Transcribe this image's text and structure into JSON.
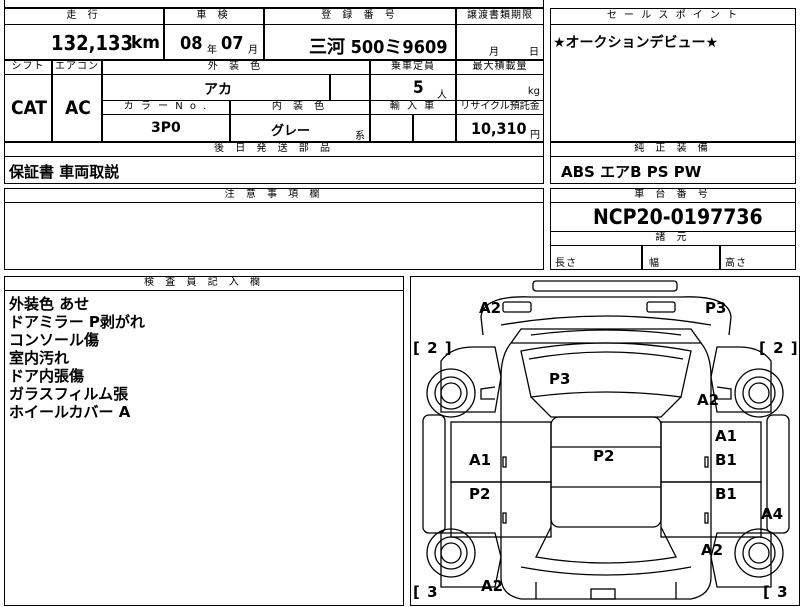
{
  "header": {
    "mileage_label": "走 行",
    "inspection_label": "車 検",
    "registration_label": "登 録 番 号",
    "transfer_label": "譲渡書類期限",
    "sales_point_label": "セ ー ル ス ポ イ ン ト",
    "mileage_value": "132,133",
    "mileage_unit": "km",
    "inspection_year": "08",
    "inspection_year_unit": "年",
    "inspection_month": "07",
    "inspection_month_unit": "月",
    "registration_value": "三河 500ミ9609",
    "transfer_month_unit": "月",
    "transfer_day_unit": "日",
    "sales_point_text": "★オークションデビュー★"
  },
  "specs": {
    "shift_label": "シフト",
    "aircon_label": "エアコン",
    "exterior_color_label": "外 装 色",
    "capacity_label": "乗車定員",
    "max_load_label": "最大積載量",
    "shift_value": "CAT",
    "aircon_value": "AC",
    "exterior_color_value": "アカ",
    "capacity_value": "5",
    "capacity_unit": "人",
    "max_load_unit": "kg",
    "color_no_label": "カ ラ ー N o .",
    "interior_color_label": "内 装 色",
    "import_label": "輸 入 車",
    "recycle_label": "リサイクル預託金",
    "color_no_value": "3P0",
    "interior_color_value": "グレー",
    "interior_color_suffix": "系",
    "recycle_value": "10,310",
    "recycle_unit": "円"
  },
  "parts": {
    "later_parts_label": "後 日 発 送 部 品",
    "later_parts_value": "保証書 車両取説",
    "genuine_equipment_label": "純 正 装 備",
    "genuine_equipment_value": "ABS エアB PS PW"
  },
  "notes": {
    "caution_label": "注 意 事 項 欄",
    "chassis_label": "車 台 番 号",
    "chassis_value": "NCP20-0197736",
    "dimensions_label": "諸 元",
    "length_label": "長さ",
    "width_label": "幅",
    "height_label": "高さ"
  },
  "inspector": {
    "label": "検 査 員 記 入 欄",
    "lines": [
      "外装色 あせ",
      "ドアミラー P剥がれ",
      "コンソール傷",
      "室内汚れ",
      "ドア内張傷",
      "ガラスフィルム張",
      "ホイールカバー A"
    ]
  },
  "diagram": {
    "marks": {
      "fl_corner": "A2",
      "fr_corner": "P3",
      "windshield": "P3",
      "front_fender_r": "A2",
      "front_door_l": "A1",
      "front_door_r_1": "A1",
      "front_door_r_2": "B1",
      "roof": "P2",
      "rear_door_l": "P2",
      "rear_door_r": "B1",
      "rear_side_r": "A4",
      "rear_fender_r": "A2",
      "rear_corner_l": "A2"
    },
    "brackets": {
      "front_left": "[ 2 ]",
      "front_right": "[ 2 ]",
      "rear_left": "[ 3",
      "rear_right": "[ 3"
    }
  }
}
